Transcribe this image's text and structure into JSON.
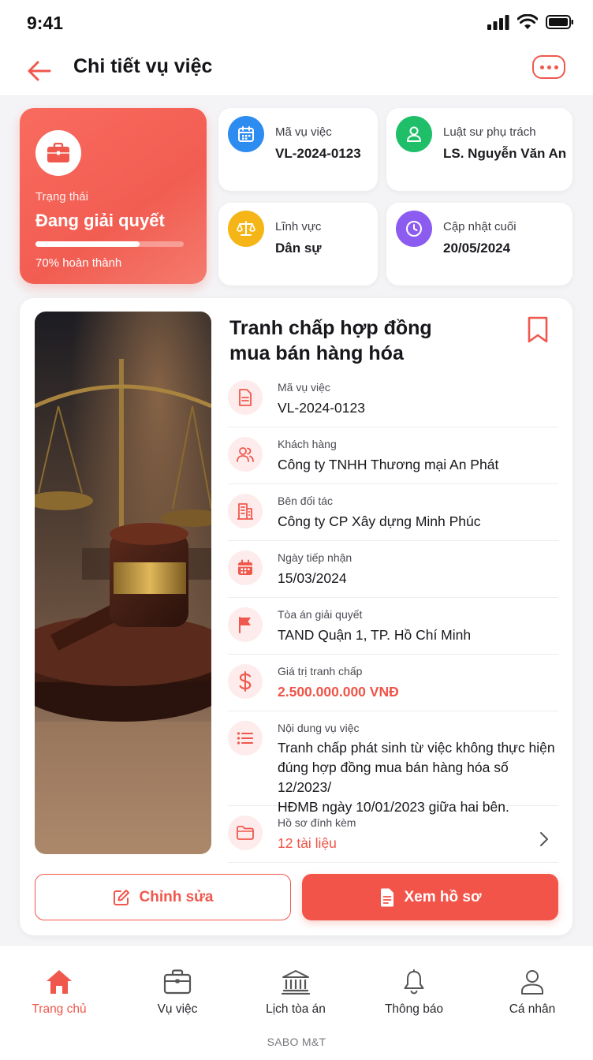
{
  "status_bar": {
    "time": "9:41"
  },
  "header": {
    "title": "Chi tiết vụ việc"
  },
  "status_card": {
    "label": "Trạng thái",
    "value": "Đang giải quyết",
    "progress": 0.7,
    "progress_text": "70% hoàn thành"
  },
  "info_tiles": [
    {
      "label": "Mã vụ việc",
      "value": "VL-2024-0123",
      "icon": "calendar-icon",
      "color": "#2d8cf0"
    },
    {
      "label": "Luật sư phụ trách",
      "value": "LS. Nguyễn Văn An",
      "icon": "person-icon",
      "color": "#1fbf6a"
    },
    {
      "label": "Lĩnh vực",
      "value": "Dân sự",
      "icon": "scale-icon",
      "color": "#f5b516"
    },
    {
      "label": "Cập nhật cuối",
      "value": "20/05/2024",
      "icon": "clock-icon",
      "color": "#8c5cf0"
    }
  ],
  "case": {
    "title_line1": "Tranh chấp hợp đồng",
    "title_line2": "mua bán hàng hóa",
    "rows": [
      {
        "label": "Mã vụ việc",
        "value": "VL-2024-0123"
      },
      {
        "label": "Khách hàng",
        "value": "Công ty TNHH Thương mại An Phát"
      },
      {
        "label": "Bên đối tác",
        "value": "Công ty CP Xây dựng Minh Phúc"
      },
      {
        "label": "Ngày tiếp nhận",
        "value": "15/03/2024"
      },
      {
        "label": "Tòa án giải quyết",
        "value": "TAND Quận 1, TP. Hồ Chí Minh"
      },
      {
        "label": "Giá trị tranh chấp",
        "value": "2.500.000.000 VNĐ"
      },
      {
        "label": "Nội dung vụ việc",
        "lines": [
          "Tranh chấp phát sinh từ việc không thực hiện",
          "đúng hợp đồng mua bán hàng hóa số 12/2023/",
          "HĐMB ngày 10/01/2023 giữa hai bên."
        ]
      },
      {
        "label": "Hồ sơ đính kèm",
        "value": "12 tài liệu"
      }
    ]
  },
  "actions": {
    "edit": "Chỉnh sửa",
    "view": "Xem hồ sơ"
  },
  "tabs": [
    {
      "label": "Trang chủ",
      "icon": "home-icon"
    },
    {
      "label": "Vụ việc",
      "icon": "briefcase-icon"
    },
    {
      "label": "Lịch tòa án",
      "icon": "courthouse-icon"
    },
    {
      "label": "Thông báo",
      "icon": "bell-icon"
    },
    {
      "label": "Cá nhân",
      "icon": "user-icon"
    }
  ],
  "brand": "SABO M&T",
  "colors": {
    "accent": "#f0574d",
    "accent_light": "#fdeceb"
  }
}
